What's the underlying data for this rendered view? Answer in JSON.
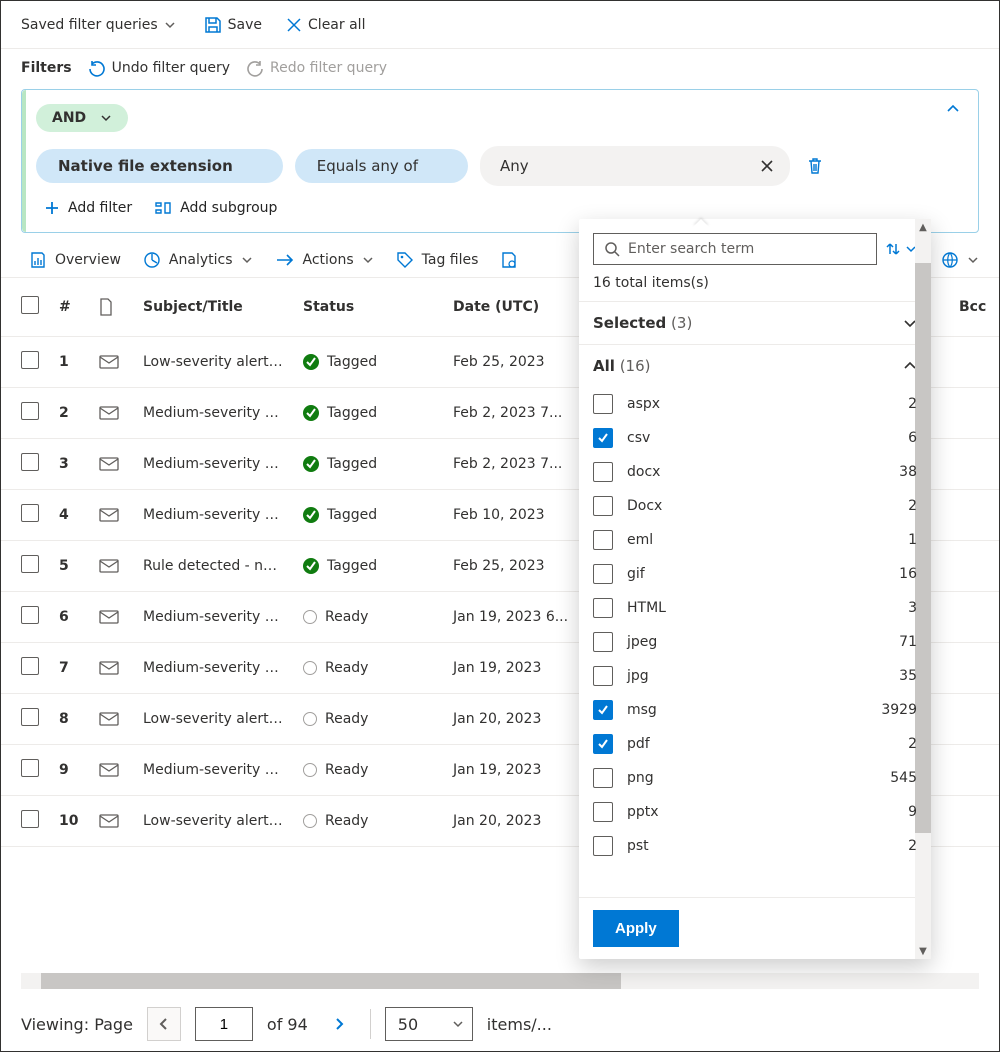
{
  "toolbar": {
    "saved_queries": "Saved filter queries",
    "save": "Save",
    "clear_all": "Clear all"
  },
  "filters": {
    "label": "Filters",
    "undo": "Undo filter query",
    "redo": "Redo filter query"
  },
  "builder": {
    "operator": "AND",
    "field": "Native file extension",
    "comparator": "Equals any of",
    "value": "Any",
    "add_filter": "Add filter",
    "add_subgroup": "Add subgroup"
  },
  "tabs": {
    "overview": "Overview",
    "analytics": "Analytics",
    "actions": "Actions",
    "tag_files": "Tag files"
  },
  "columns": {
    "idx": "#",
    "subject": "Subject/Title",
    "status": "Status",
    "date": "Date (UTC)",
    "bcc": "Bcc"
  },
  "status_labels": {
    "tagged": "Tagged",
    "ready": "Ready"
  },
  "rows": [
    {
      "idx": "1",
      "subject": "Low-severity alert: ...",
      "status": "tagged",
      "date": "Feb 25, 2023"
    },
    {
      "idx": "2",
      "subject": "Medium-severity al...",
      "status": "tagged",
      "date": "Feb 2, 2023 7..."
    },
    {
      "idx": "3",
      "subject": "Medium-severity al...",
      "status": "tagged",
      "date": "Feb 2, 2023 7..."
    },
    {
      "idx": "4",
      "subject": "Medium-severity al...",
      "status": "tagged",
      "date": "Feb 10, 2023"
    },
    {
      "idx": "5",
      "subject": "Rule detected - na...",
      "status": "tagged",
      "date": "Feb 25, 2023"
    },
    {
      "idx": "6",
      "subject": "Medium-severity al...",
      "status": "ready",
      "date": "Jan 19, 2023 6..."
    },
    {
      "idx": "7",
      "subject": "Medium-severity al...",
      "status": "ready",
      "date": "Jan 19, 2023"
    },
    {
      "idx": "8",
      "subject": "Low-severity alert: ...",
      "status": "ready",
      "date": "Jan 20, 2023"
    },
    {
      "idx": "9",
      "subject": "Medium-severity al...",
      "status": "ready",
      "date": "Jan 19, 2023"
    },
    {
      "idx": "10",
      "subject": "Low-severity alert: ...",
      "status": "ready",
      "date": "Jan 20, 2023"
    }
  ],
  "pager": {
    "viewing": "Viewing: Page",
    "page": "1",
    "of": "of 94",
    "page_size": "50",
    "items_per": "items/..."
  },
  "dropdown": {
    "search_placeholder": "Enter search term",
    "total": "16 total items(s)",
    "selected_label": "Selected",
    "selected_count": "(3)",
    "all_label": "All",
    "all_count": "(16)",
    "apply": "Apply",
    "items": [
      {
        "label": "aspx",
        "count": "2",
        "checked": false
      },
      {
        "label": "csv",
        "count": "6",
        "checked": true
      },
      {
        "label": "docx",
        "count": "38",
        "checked": false
      },
      {
        "label": "Docx",
        "count": "2",
        "checked": false
      },
      {
        "label": "eml",
        "count": "1",
        "checked": false
      },
      {
        "label": "gif",
        "count": "16",
        "checked": false
      },
      {
        "label": "HTML",
        "count": "3",
        "checked": false
      },
      {
        "label": "jpeg",
        "count": "71",
        "checked": false
      },
      {
        "label": "jpg",
        "count": "35",
        "checked": false
      },
      {
        "label": "msg",
        "count": "3929",
        "checked": true
      },
      {
        "label": "pdf",
        "count": "2",
        "checked": true
      },
      {
        "label": "png",
        "count": "545",
        "checked": false
      },
      {
        "label": "pptx",
        "count": "9",
        "checked": false
      },
      {
        "label": "pst",
        "count": "2",
        "checked": false
      }
    ]
  }
}
